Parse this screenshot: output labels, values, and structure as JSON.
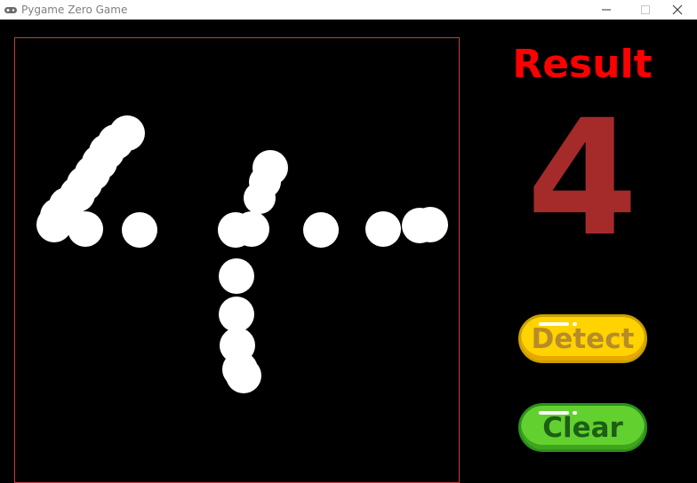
{
  "window": {
    "title": "Pygame Zero Game",
    "icon": "gamepad-icon",
    "controls": [
      "minimize-icon",
      "maximize-icon",
      "close-icon"
    ]
  },
  "canvas": {
    "stroke_color": "#ffffff",
    "border_color": "#c04040",
    "background": "#000000"
  },
  "result": {
    "label": "Result",
    "label_color": "#ff0000",
    "value": "4",
    "value_color": "#a52a2a"
  },
  "buttons": {
    "detect_label": "Detect",
    "detect_color": "#ffd300",
    "clear_label": "Clear",
    "clear_color": "#62d12f"
  }
}
